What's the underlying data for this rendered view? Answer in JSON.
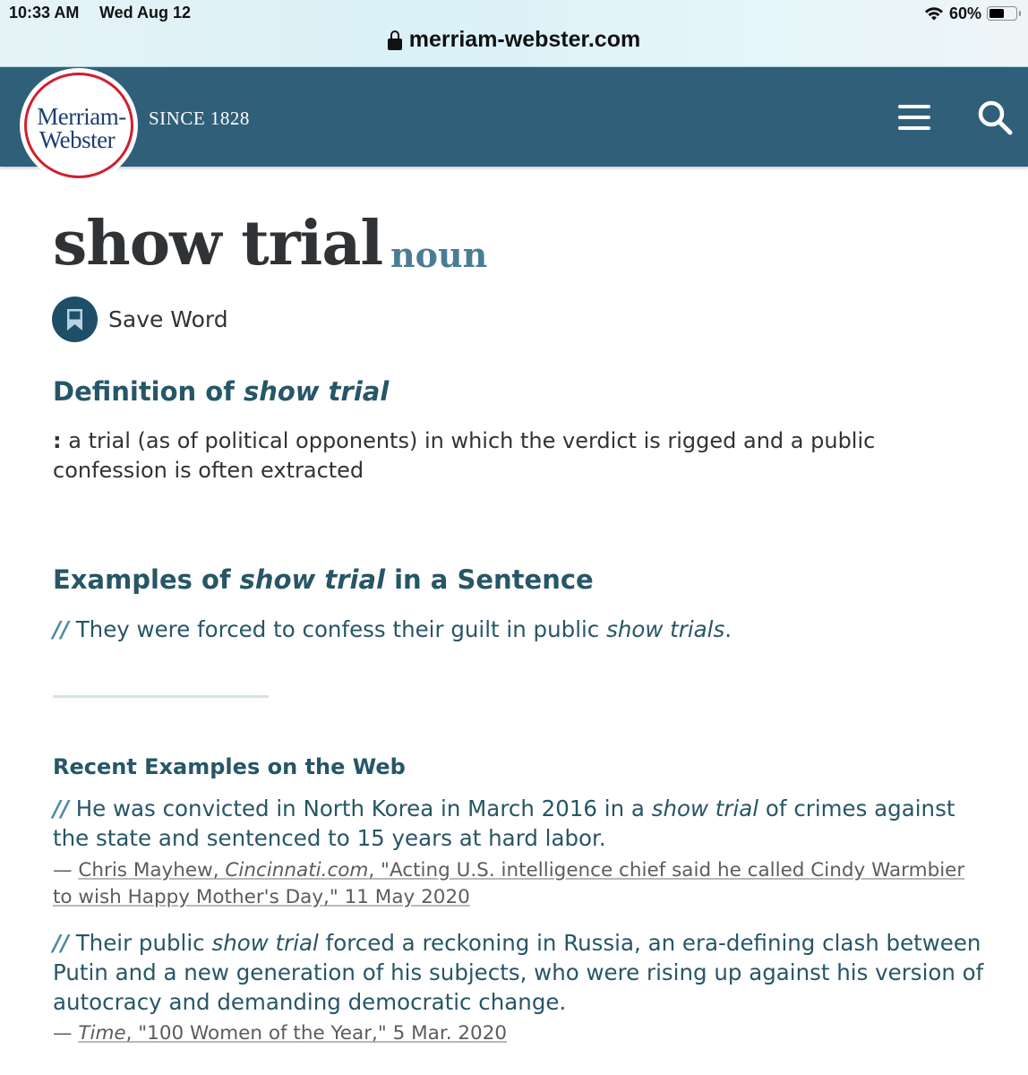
{
  "status_bar": {
    "time": "10:33 AM",
    "date": "Wed Aug 12",
    "battery_percent_label": "60%",
    "battery_level": 0.6
  },
  "address_bar": {
    "url": "merriam-webster.com"
  },
  "header": {
    "logo_line1": "Merriam-",
    "logo_line2": "Webster",
    "tagline": "SINCE 1828",
    "colors": {
      "header_bg": "#305f7a",
      "logo_ring": "#d0202f",
      "logo_text": "#1d3f72"
    }
  },
  "entry": {
    "headword": "show trial",
    "part_of_speech": "noun",
    "save_word_label": "Save Word"
  },
  "definition": {
    "heading_prefix": "Definition of ",
    "heading_term": "show trial",
    "colon": ":",
    "text": " a trial (as of political opponents) in which the verdict is rigged and a public confession is often extracted"
  },
  "examples": {
    "heading_prefix": "Examples of ",
    "heading_term": "show trial",
    "heading_suffix": " in a Sentence",
    "sentence": {
      "slashes": "//",
      "before": " They were forced to confess their guilt in public ",
      "term": "show trials",
      "after": "."
    }
  },
  "recent_examples": {
    "heading": "Recent Examples on the Web",
    "items": [
      {
        "slashes": "//",
        "before": " He was convicted in North Korea in March 2016 in a ",
        "term": "show trial",
        "after": " of crimes against the state and sentenced to 15 years at hard labor.",
        "dash": "— ",
        "author": "Chris Mayhew, ",
        "publication": "Cincinnati.com",
        "title_date": ", \"Acting U.S. intelligence chief said he called Cindy Warmbier to wish Happy Mother's Day,\" 11 May 2020"
      },
      {
        "slashes": "//",
        "before": " Their public ",
        "term": "show trial",
        "after": " forced a reckoning in Russia, an era-defining clash between Putin and a new generation of his subjects, who were rising up against his version of autocracy and demanding democratic change.",
        "dash": "— ",
        "author": "",
        "publication": "Time",
        "title_date": ", \"100 Women of the Year,\" 5 Mar. 2020"
      }
    ]
  },
  "icons": {
    "wifi": "wifi-icon",
    "battery": "battery-icon",
    "lock": "lock-icon",
    "menu": "hamburger-menu-icon",
    "search": "search-icon",
    "bookmark": "bookmark-icon"
  }
}
